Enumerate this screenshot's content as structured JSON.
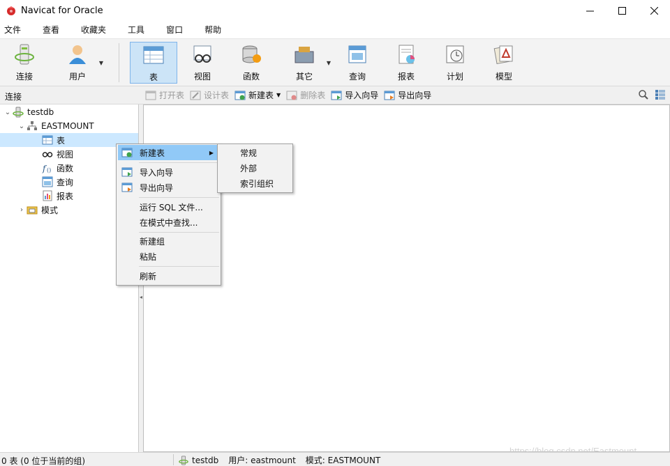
{
  "window": {
    "title": "Navicat for Oracle",
    "controls": {
      "minimize": "minimize-icon",
      "maximize": "maximize-icon",
      "close": "close-icon"
    }
  },
  "menubar": {
    "items": [
      "文件",
      "查看",
      "收藏夹",
      "工具",
      "窗口",
      "帮助"
    ]
  },
  "toolbar": {
    "connect": "连接",
    "user": "用户",
    "table": "表",
    "view": "视图",
    "function": "函数",
    "other": "其它",
    "query": "查询",
    "report": "报表",
    "schedule": "计划",
    "model": "模型"
  },
  "subbar": {
    "connection_label": "连接",
    "open_table": "打开表",
    "design_table": "设计表",
    "new_table": "新建表",
    "delete_table": "删除表",
    "import_wizard": "导入向导",
    "export_wizard": "导出向导"
  },
  "tree": {
    "connection": "testdb",
    "schema": "EASTMOUNT",
    "children": [
      "表",
      "视图",
      "函数",
      "查询",
      "报表"
    ],
    "schemas_node": "模式"
  },
  "context_menu": {
    "new_table": "新建表",
    "import_wizard": "导入向导",
    "export_wizard": "导出向导",
    "run_sql": "运行 SQL 文件...",
    "find_in_schema": "在模式中查找...",
    "new_group": "新建组",
    "paste": "粘贴",
    "refresh": "刷新"
  },
  "submenu": {
    "items": [
      "常规",
      "外部",
      "索引组织"
    ]
  },
  "statusbar": {
    "left": "0 表 (0 位于当前的组)",
    "connection": "testdb",
    "user": "用户: eastmount",
    "schema": "模式: EASTMOUNT"
  },
  "watermark": "https://blog.csdn.net/Eastmount",
  "colors": {
    "selected_tool": "#cce4f7",
    "selected_tree": "#cce8ff",
    "menu_highlight": "#91c9f7"
  }
}
